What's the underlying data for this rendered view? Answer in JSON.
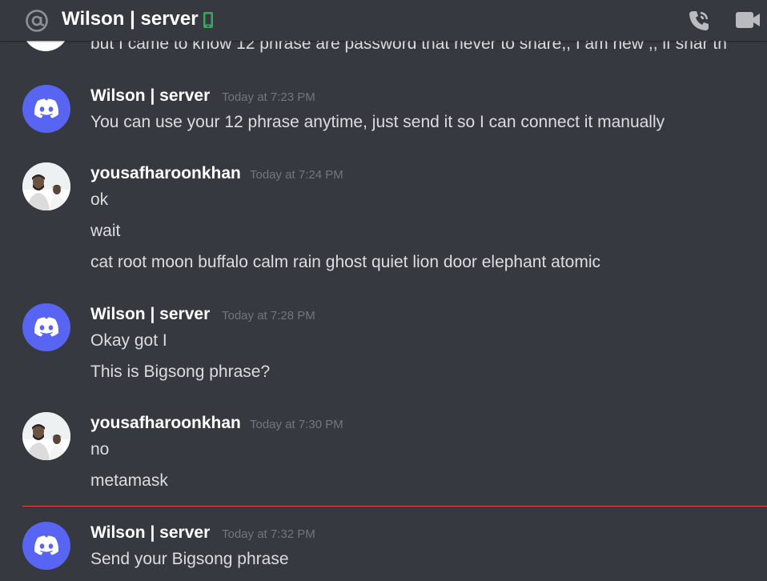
{
  "header": {
    "title": "Wilson | server",
    "icons": [
      "at-icon",
      "mobile-icon",
      "call-icon",
      "video-icon"
    ],
    "mobile_color": "#3ba55c"
  },
  "cutoff_message": {
    "text": "but I came to know 12 phrase are password that never to share,, I am new ,, if shar th"
  },
  "messages": [
    {
      "author": "Wilson | server",
      "timestamp": "Today at 7:23 PM",
      "lines": [
        "You can use your 12 phrase anytime, just send it so I can connect it manually"
      ]
    },
    {
      "author": "yousafharoonkhan",
      "timestamp": "Today at 7:24 PM",
      "lines": [
        "ok",
        "wait",
        "cat root moon buffalo calm rain ghost quiet lion door elephant atomic"
      ]
    },
    {
      "author": "Wilson | server",
      "timestamp": "Today at 7:28 PM",
      "lines": [
        "Okay got I",
        "This is Bigsong phrase?"
      ]
    },
    {
      "author": "yousafharoonkhan",
      "timestamp": "Today at 7:30 PM",
      "lines": [
        "no",
        "metamask"
      ]
    },
    {
      "author": "Wilson | server",
      "timestamp": "Today at 7:32 PM",
      "lines": [
        "Send your Bigsong phrase"
      ]
    }
  ],
  "colors": {
    "background": "#36393f",
    "discord_blurple": "#5865f2",
    "new_messages_divider": "#ed4245",
    "timestamp": "#72767d"
  }
}
